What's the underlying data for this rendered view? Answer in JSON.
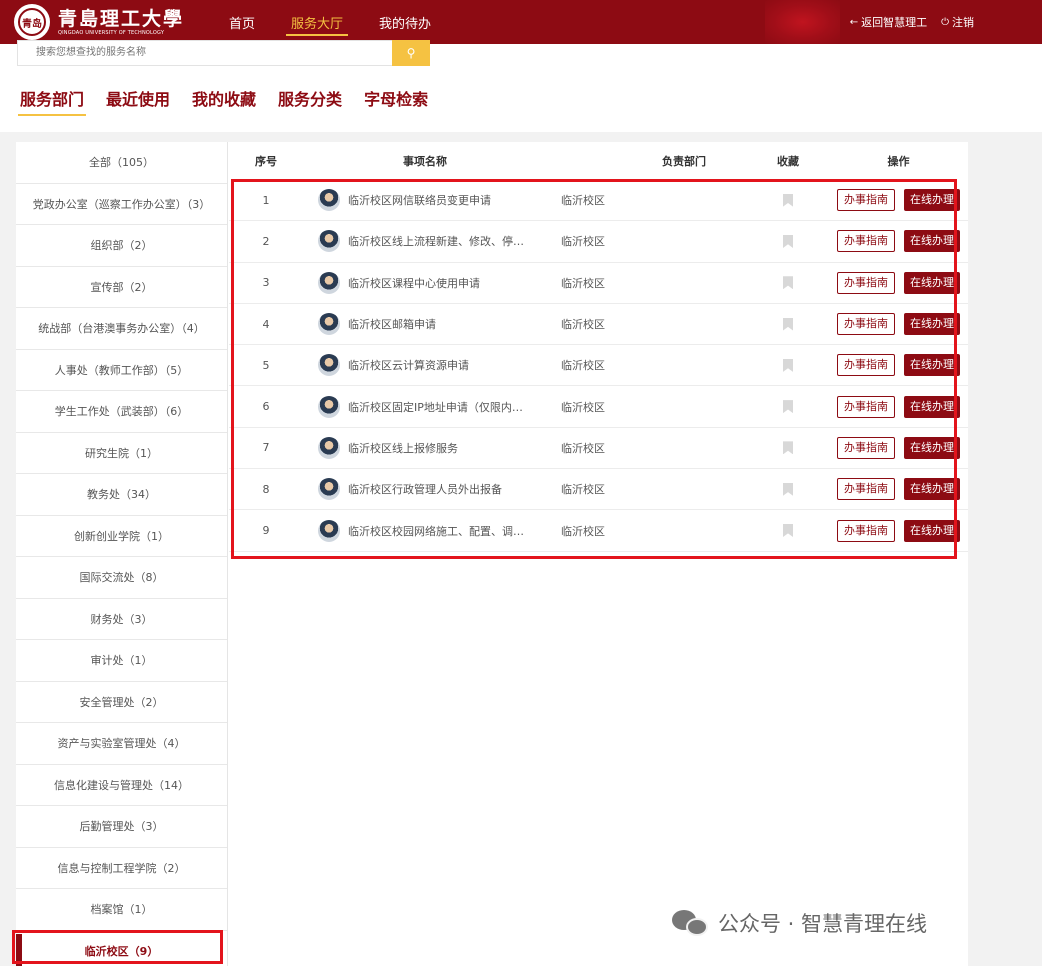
{
  "header": {
    "logo_cn": "青島理工大學",
    "logo_en": "QINGDAO UNIVERSITY OF TECHNOLOGY",
    "seal_text": "青岛",
    "nav": [
      {
        "label": "首页",
        "active": false
      },
      {
        "label": "服务大厅",
        "active": true
      },
      {
        "label": "我的待办",
        "active": false
      }
    ],
    "back_link": "返回智慧理工",
    "logout": "注销",
    "brand_color": "#8d0b13",
    "accent_color": "#f5c242"
  },
  "search": {
    "placeholder": "搜索您想查找的服务名称",
    "button_icon": "search-icon"
  },
  "tabs": [
    {
      "label": "服务部门",
      "active": true
    },
    {
      "label": "最近使用",
      "active": false
    },
    {
      "label": "我的收藏",
      "active": false
    },
    {
      "label": "服务分类",
      "active": false
    },
    {
      "label": "字母检索",
      "active": false
    }
  ],
  "sidebar": {
    "items": [
      {
        "label": "全部（105）"
      },
      {
        "label": "党政办公室（巡察工作办公室）（3）"
      },
      {
        "label": "组织部（2）"
      },
      {
        "label": "宣传部（2）"
      },
      {
        "label": "统战部（台港澳事务办公室）（4）"
      },
      {
        "label": "人事处（教师工作部）（5）"
      },
      {
        "label": "学生工作处（武装部）（6）"
      },
      {
        "label": "研究生院（1）"
      },
      {
        "label": "教务处（34）"
      },
      {
        "label": "创新创业学院（1）"
      },
      {
        "label": "国际交流处（8）"
      },
      {
        "label": "财务处（3）"
      },
      {
        "label": "审计处（1）"
      },
      {
        "label": "安全管理处（2）"
      },
      {
        "label": "资产与实验室管理处（4）"
      },
      {
        "label": "信息化建设与管理处（14）"
      },
      {
        "label": "后勤管理处（3）"
      },
      {
        "label": "信息与控制工程学院（2）"
      },
      {
        "label": "档案馆（1）"
      },
      {
        "label": "临沂校区（9）",
        "active": true
      }
    ]
  },
  "table": {
    "headers": {
      "no": "序号",
      "name": "事项名称",
      "dept": "负责部门",
      "fav": "收藏",
      "op": "操作"
    },
    "guide_label": "办事指南",
    "online_label": "在线办理",
    "rows": [
      {
        "no": "1",
        "name": "临沂校区网信联络员变更申请",
        "dept": "临沂校区"
      },
      {
        "no": "2",
        "name": "临沂校区线上流程新建、修改、停…",
        "dept": "临沂校区"
      },
      {
        "no": "3",
        "name": "临沂校区课程中心使用申请",
        "dept": "临沂校区"
      },
      {
        "no": "4",
        "name": "临沂校区邮箱申请",
        "dept": "临沂校区"
      },
      {
        "no": "5",
        "name": "临沂校区云计算资源申请",
        "dept": "临沂校区"
      },
      {
        "no": "6",
        "name": "临沂校区固定IP地址申请（仅限内…",
        "dept": "临沂校区"
      },
      {
        "no": "7",
        "name": "临沂校区线上报修服务",
        "dept": "临沂校区"
      },
      {
        "no": "8",
        "name": "临沂校区行政管理人员外出报备",
        "dept": "临沂校区"
      },
      {
        "no": "9",
        "name": "临沂校区校园网络施工、配置、调…",
        "dept": "临沂校区"
      }
    ]
  },
  "watermark": "公众号 · 智慧青理在线",
  "highlight_color": "#e3141c"
}
